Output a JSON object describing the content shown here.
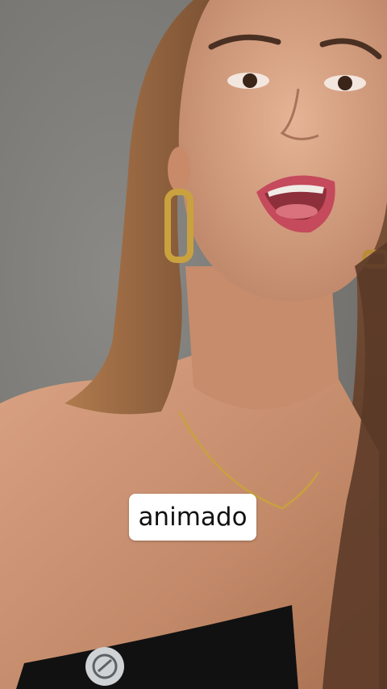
{
  "video": {
    "subtitle": "animado"
  },
  "colors": {
    "background": "#7d7c78",
    "skin": "#c98f70",
    "hair": "#6b4630",
    "top": "#111111",
    "earring": "#c9a13e",
    "caption_bg": "#ffffff"
  }
}
